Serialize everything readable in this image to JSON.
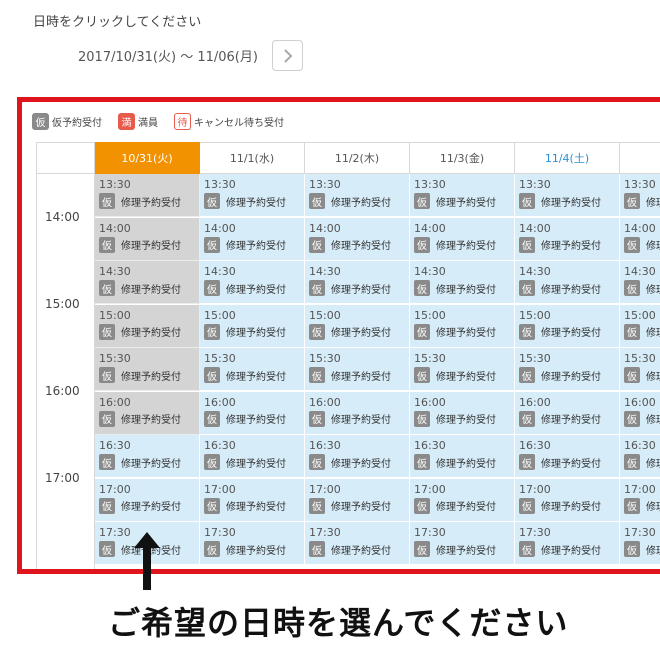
{
  "page": {
    "instruction": "日時をクリックしてください",
    "date_range": "2017/10/31(火) 〜 11/06(月)"
  },
  "legend": [
    {
      "chip": "仮",
      "label": "仮予約受付",
      "style": "gray"
    },
    {
      "chip": "満",
      "label": "満員",
      "style": "red"
    },
    {
      "chip": "待",
      "label": "キャンセル待ち受付",
      "style": "white"
    }
  ],
  "days": [
    {
      "label": "10/31(火)",
      "state": "selected"
    },
    {
      "label": "11/1(水)",
      "state": "normal"
    },
    {
      "label": "11/2(木)",
      "state": "normal"
    },
    {
      "label": "11/3(金)",
      "state": "normal"
    },
    {
      "label": "11/4(土)",
      "state": "saturday"
    },
    {
      "label": "11/",
      "state": "normal"
    }
  ],
  "hours": [
    "14:00",
    "15:00",
    "16:00",
    "17:00"
  ],
  "slot_times": [
    "13:30",
    "14:00",
    "14:30",
    "15:00",
    "15:30",
    "16:00",
    "16:30",
    "17:00",
    "17:30"
  ],
  "slot_chip": "仮",
  "slot_label": "修理予約受付",
  "gray_slots_day0": 6,
  "colors": {
    "selected_day": "#f39200",
    "saturday": "#2a8fd0",
    "slot_available": "#d6ecf8",
    "slot_past": "#d4d4d4",
    "frame": "#e0141c"
  },
  "caption": "ご希望の日時を選んでください"
}
